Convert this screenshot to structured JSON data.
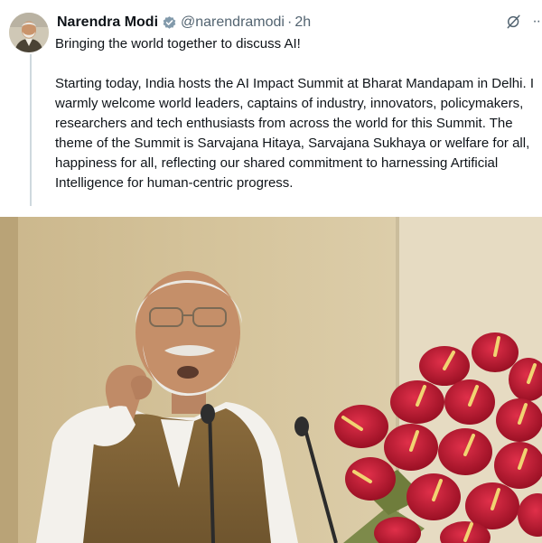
{
  "author": {
    "name": "Narendra Modi",
    "handle": "@narendramodi",
    "separator": "·",
    "time": "2h"
  },
  "tweet": {
    "headline": "Bringing the world together to discuss AI!",
    "paragraph": "Starting today, India hosts the AI Impact Summit at Bharat Mandapam in Delhi. I warmly welcome world leaders, captains of industry, innovators, policymakers, researchers and tech enthusiasts from across the world for this Summit. The theme of the Summit is Sarvajana Hitaya, Sarvajana Sukhaya or welfare for all, happiness for all, reflecting our shared commitment to harnessing Artificial Intelligence for human-centric progress."
  },
  "icons": {
    "verified": "verified-badge-icon",
    "grok": "grok-icon",
    "more": "more-options-icon"
  },
  "colors": {
    "verified_badge": "#829aab",
    "secondary_text": "#536471",
    "primary_text": "#0f1419",
    "thread_line": "#cfd9de"
  }
}
